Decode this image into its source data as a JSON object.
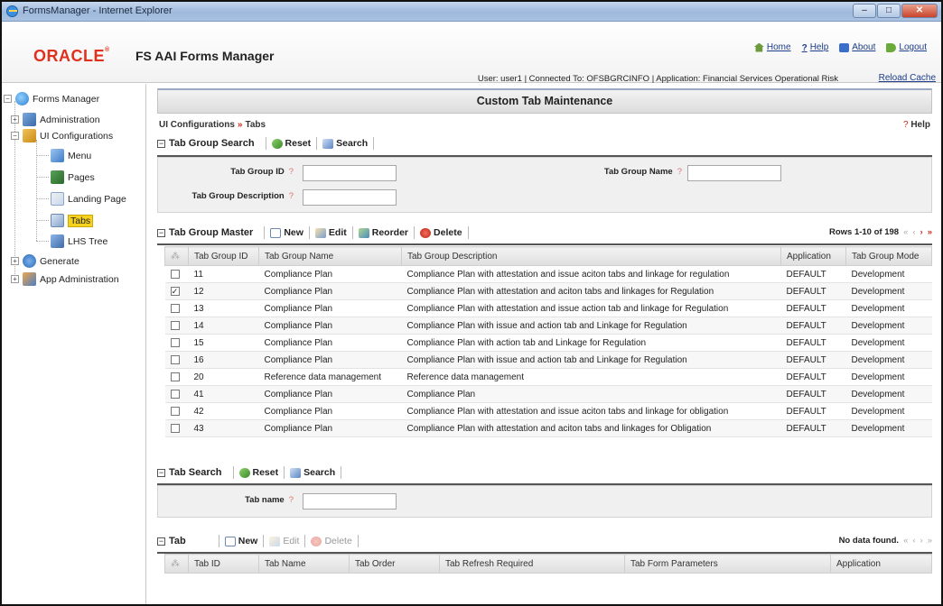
{
  "window": {
    "title": "FormsManager - Internet Explorer"
  },
  "header": {
    "logo": "ORACLE",
    "product": "FS AAI Forms Manager",
    "links": {
      "home": "Home",
      "help": "Help",
      "about": "About",
      "logout": "Logout"
    },
    "user_line": "User: user1  |  Connected To: OFSBGRCINFO  |  Application: Financial Services Operational Risk",
    "reload": "Reload Cache"
  },
  "tree": {
    "root": "Forms Manager",
    "administration": "Administration",
    "ui_configurations": "UI Configurations",
    "menu": "Menu",
    "pages": "Pages",
    "landing_page": "Landing Page",
    "tabs": "Tabs",
    "lhs_tree": "LHS Tree",
    "generate": "Generate",
    "app_administration": "App Administration"
  },
  "main": {
    "title": "Custom Tab Maintenance",
    "breadcrumb": {
      "root": "UI Configurations",
      "sep": "»",
      "current": "Tabs"
    },
    "help": "Help",
    "group_search": {
      "title": "Tab Group Search",
      "reset": "Reset",
      "search": "Search",
      "id_label": "Tab Group ID",
      "id_value": "",
      "name_label": "Tab Group Name",
      "name_value": "",
      "desc_label": "Tab Group Description",
      "desc_value": ""
    },
    "group_master": {
      "title": "Tab Group Master",
      "new": "New",
      "edit": "Edit",
      "reorder": "Reorder",
      "delete": "Delete",
      "rows_info": "Rows 1-10 of 198",
      "columns": [
        "Tab Group ID",
        "Tab Group Name",
        "Tab Group Description",
        "Application",
        "Tab Group Mode"
      ],
      "rows": [
        {
          "checked": false,
          "id": "11",
          "name": "Compliance Plan",
          "desc": "Compliance Plan with attestation and issue aciton tabs and linkage for regulation",
          "app": "DEFAULT",
          "mode": "Development"
        },
        {
          "checked": true,
          "id": "12",
          "name": "Compliance Plan",
          "desc": "Compliance Plan with attestation and aciton tabs and linkages for Regulation",
          "app": "DEFAULT",
          "mode": "Development"
        },
        {
          "checked": false,
          "id": "13",
          "name": "Compliance Plan",
          "desc": "Compliance Plan with attestation and issue action tab and linkage for Regulation",
          "app": "DEFAULT",
          "mode": "Development"
        },
        {
          "checked": false,
          "id": "14",
          "name": "Compliance Plan",
          "desc": "Compliance Plan with issue and action tab and Linkage for Regulation",
          "app": "DEFAULT",
          "mode": "Development"
        },
        {
          "checked": false,
          "id": "15",
          "name": "Compliance Plan",
          "desc": "Compliance Plan with action tab and Linkage for Regulation",
          "app": "DEFAULT",
          "mode": "Development"
        },
        {
          "checked": false,
          "id": "16",
          "name": "Compliance Plan",
          "desc": "Compliance Plan with issue and action tab and Linkage for Regulation",
          "app": "DEFAULT",
          "mode": "Development"
        },
        {
          "checked": false,
          "id": "20",
          "name": "Reference data management",
          "desc": "Reference data management",
          "app": "DEFAULT",
          "mode": "Development"
        },
        {
          "checked": false,
          "id": "41",
          "name": "Compliance Plan",
          "desc": "Compliance Plan",
          "app": "DEFAULT",
          "mode": "Development"
        },
        {
          "checked": false,
          "id": "42",
          "name": "Compliance Plan",
          "desc": "Compliance Plan with attestation and issue aciton tabs and linkage for obligation",
          "app": "DEFAULT",
          "mode": "Development"
        },
        {
          "checked": false,
          "id": "43",
          "name": "Compliance Plan",
          "desc": "Compliance Plan with attestation and aciton tabs and linkages for Obligation",
          "app": "DEFAULT",
          "mode": "Development"
        }
      ]
    },
    "tab_search": {
      "title": "Tab Search",
      "reset": "Reset",
      "search": "Search",
      "name_label": "Tab name",
      "name_value": ""
    },
    "tab": {
      "title": "Tab",
      "new": "New",
      "edit": "Edit",
      "delete": "Delete",
      "rows_info": "No data found.",
      "columns": [
        "Tab ID",
        "Tab Name",
        "Tab Order",
        "Tab Refresh Required",
        "Tab Form Parameters",
        "Application"
      ]
    }
  }
}
